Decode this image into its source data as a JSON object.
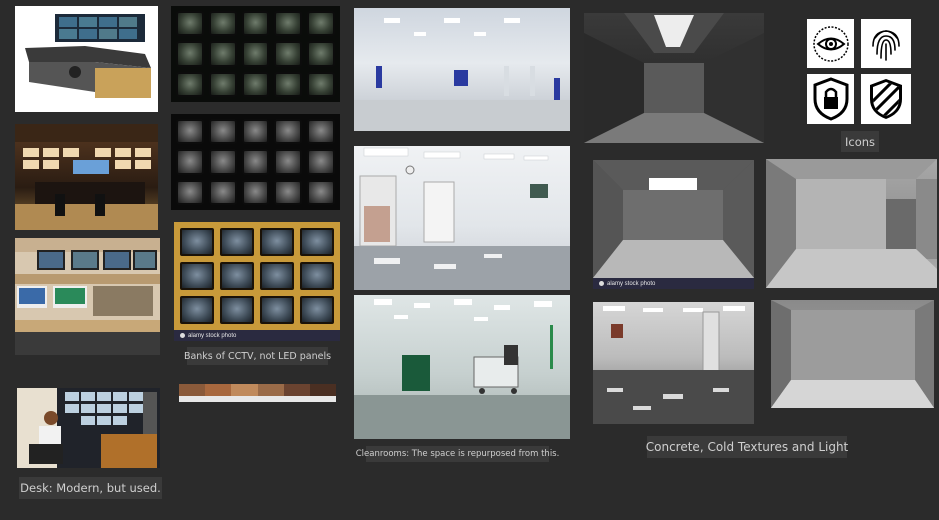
{
  "captions": {
    "desk": "Desk: Modern, but used.",
    "cctv": "Banks of CCTV, not LED panels",
    "cleanrooms": "Cleanrooms: The space is repurposed from this.",
    "concrete": "Concrete, Cold Textures and Light",
    "icons": "Icons"
  },
  "watermark": "alamy stock photo",
  "icons": [
    "eye-icon",
    "fingerprint-icon",
    "lock-shield-icon",
    "stripe-shield-icon"
  ],
  "palette": [
    "#8a5a3a",
    "#a8683e",
    "#c08a5c",
    "#9a6b48",
    "#6a4330",
    "#4a2f22"
  ]
}
